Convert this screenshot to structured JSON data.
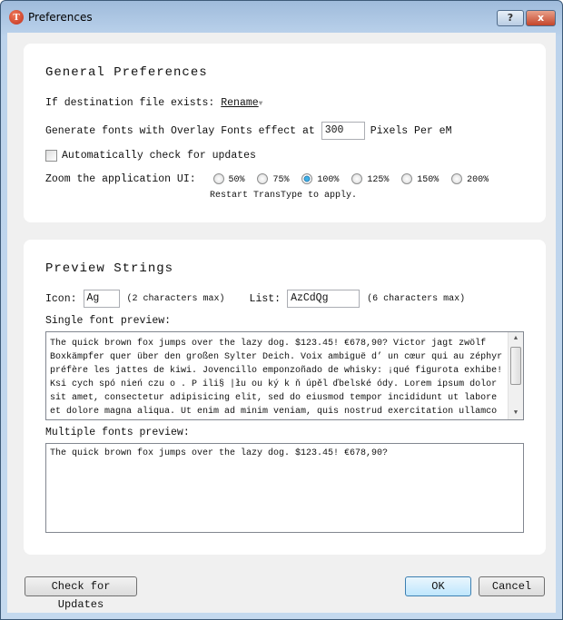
{
  "window": {
    "title": "Preferences",
    "icon": "T",
    "help": "?",
    "close": "x"
  },
  "general": {
    "heading": "General Preferences",
    "dest_label": "If destination file exists:",
    "dest_value": "Rename",
    "overlay_label": "Generate fonts with Overlay Fonts effect at",
    "overlay_value": "300",
    "overlay_unit": "Pixels Per eM",
    "auto_check_label": "Automatically check for updates",
    "auto_check_checked": false,
    "zoom_label": "Zoom the application UI:",
    "zoom_options": [
      "50%",
      "75%",
      "100%",
      "125%",
      "150%",
      "200%"
    ],
    "zoom_selected": "100%",
    "zoom_note": "Restart TransType to apply."
  },
  "preview": {
    "heading": "Preview Strings",
    "icon_label": "Icon:",
    "icon_value": "Ag",
    "icon_note": "(2 characters max)",
    "list_label": "List:",
    "list_value": "AzCdQg",
    "list_note": "(6 characters max)",
    "single_label": "Single font preview:",
    "single_lines": [
      "The quick brown fox jumps over the lazy dog. $123.45! €678,90? Victor jagt zwölf",
      "Boxkämpfer quer über den großen Sylter Deich. Voix ambiguë d’ un cœur qui au zéphyr",
      "préfère les jattes de kiwi. Jovencillo emponzoñado de whisky: ¡qué figurota exhibe!",
      "Ksi  cych spó nień czu o . P ili§ |łu ou ký k ň úpěl  ďbelské ódy. Lorem ipsum dolor",
      "sit amet, consectetur adipisicing elit, sed do eiusmod tempor incididunt ut labore",
      "et dolore magna aliqua. Ut enim ad minim veniam, quis nostrud exercitation ullamco"
    ],
    "multi_label": "Multiple fonts preview:",
    "multi_text": "The quick brown fox jumps over the lazy dog. $123.45! €678,90?"
  },
  "buttons": {
    "check": "Check for Updates",
    "ok": "OK",
    "cancel": "Cancel"
  }
}
